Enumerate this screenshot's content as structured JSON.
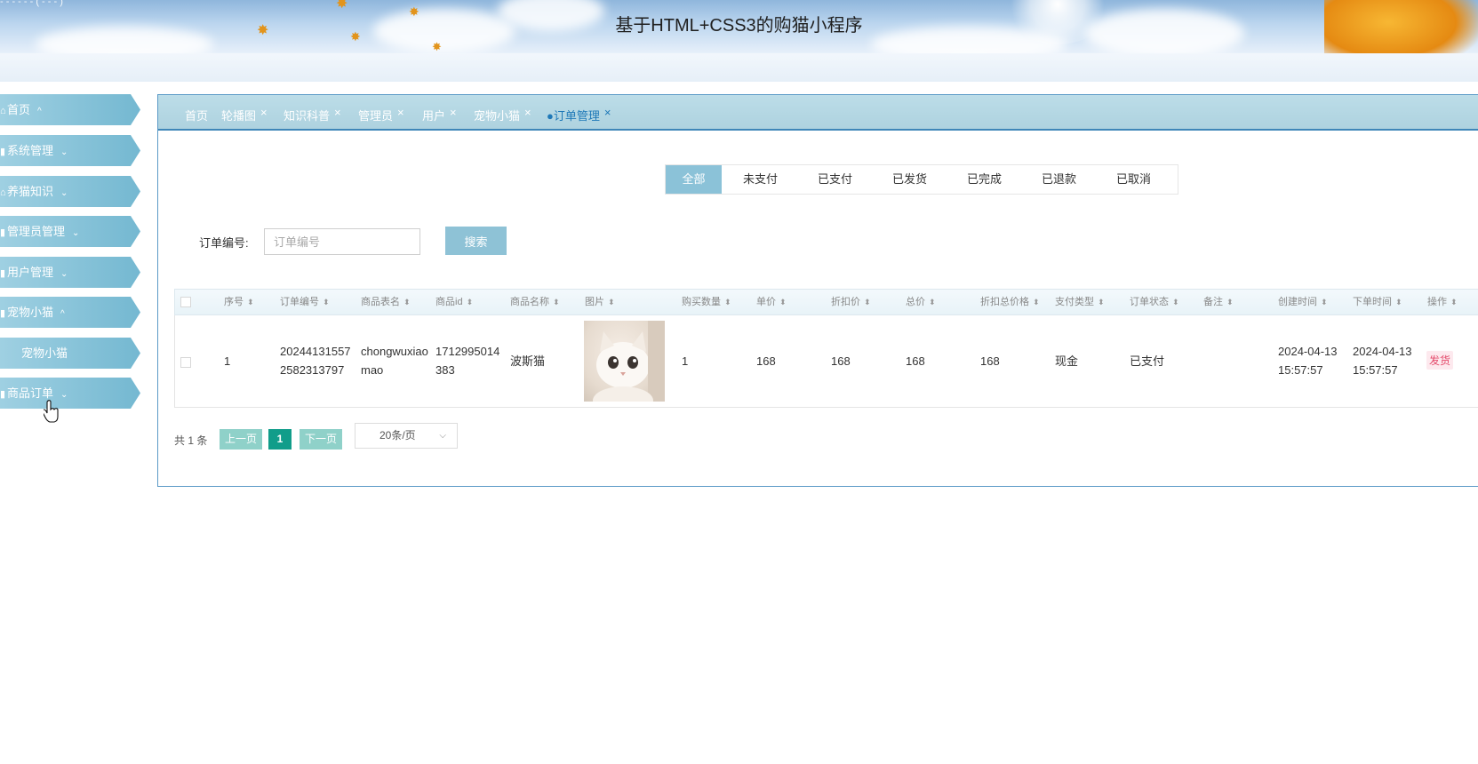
{
  "header": {
    "title": "基于HTML+CSS3的购猫小程序",
    "corner_text": "- - - - - - ( - - - )"
  },
  "sidebar": {
    "items": [
      {
        "label": "首页",
        "icon": "home-icon",
        "arrow": "^"
      },
      {
        "label": "系统管理",
        "icon": "doc-icon",
        "arrow": "v"
      },
      {
        "label": "养猫知识",
        "icon": "home-icon",
        "arrow": "v"
      },
      {
        "label": "管理员管理",
        "icon": "doc-icon",
        "arrow": "v"
      },
      {
        "label": "用户管理",
        "icon": "doc-icon",
        "arrow": "v"
      },
      {
        "label": "宠物小猫",
        "icon": "doc-icon",
        "arrow": "^"
      },
      {
        "label": "宠物小猫",
        "icon": "",
        "arrow": ""
      },
      {
        "label": "商品订单",
        "icon": "doc-icon",
        "arrow": "v"
      }
    ]
  },
  "tabs": [
    {
      "label": "首页",
      "closable": false
    },
    {
      "label": "轮播图",
      "closable": true
    },
    {
      "label": "知识科普",
      "closable": true
    },
    {
      "label": "管理员",
      "closable": true
    },
    {
      "label": "用户",
      "closable": true
    },
    {
      "label": "宠物小猫",
      "closable": true
    },
    {
      "label": "●订单管理",
      "closable": true,
      "active": true
    }
  ],
  "close_glyph": "×",
  "status_tabs": [
    "全部",
    "未支付",
    "已支付",
    "已发货",
    "已完成",
    "已退款",
    "已取消"
  ],
  "search": {
    "label": "订单编号:",
    "placeholder": "订单编号",
    "button": "搜索"
  },
  "table": {
    "columns": [
      "序号",
      "订单编号",
      "商品表名",
      "商品id",
      "商品名称",
      "图片",
      "购买数量",
      "单价",
      "折扣价",
      "总价",
      "折扣总价格",
      "支付类型",
      "订单状态",
      "备注",
      "创建时间",
      "下单时间",
      "操作"
    ],
    "sort_glyph": "⬍",
    "rows": [
      {
        "index": "1",
        "order_no_1": "20244131557",
        "order_no_2": "2582313797",
        "table_name_1": "chongwuxiao",
        "table_name_2": "mao",
        "goods_id_1": "1712995014",
        "goods_id_2": "383",
        "goods_name": "波斯猫",
        "quantity": "1",
        "price": "168",
        "discount_price": "168",
        "total": "168",
        "discount_total": "168",
        "pay_type": "现金",
        "status": "已支付",
        "remark": "",
        "created_date": "2024-04-13",
        "created_time": "15:57:57",
        "order_date": "2024-04-13",
        "order_time": "15:57:57",
        "action": "发货"
      }
    ]
  },
  "pager": {
    "total": "共 1 条",
    "prev": "上一页",
    "page": "1",
    "next": "下一页",
    "page_size": "20条/页"
  },
  "colors": {
    "sidebar": "#74b8d1",
    "tabbar": "#aed2df",
    "accent": "#8bc2d8",
    "page_active": "#119d8a",
    "danger": "#e44a6b"
  }
}
